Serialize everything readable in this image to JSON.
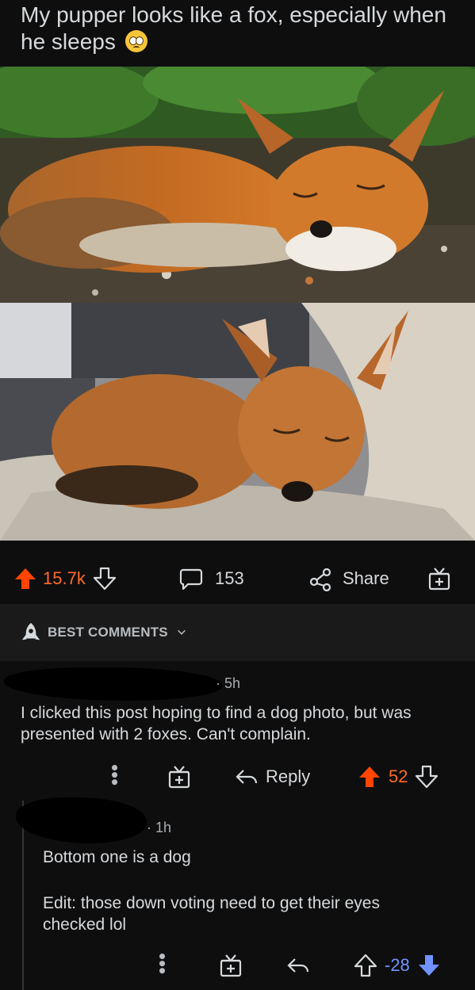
{
  "post": {
    "title": "My pupper looks like a fox, especially when he sleeps",
    "title_emoji": "pleading-face-emoji"
  },
  "actions": {
    "upvotes": "15.7k",
    "comments": "153",
    "share_label": "Share"
  },
  "comments_header": {
    "label": "BEST COMMENTS"
  },
  "comments": [
    {
      "age": "5h",
      "text": "I clicked this post hoping to find a dog photo, but was presented with 2 foxes. Can't complain.",
      "reply_label": "Reply",
      "score": "52"
    },
    {
      "age": "1h",
      "text_line1": "Bottom one is a dog",
      "text_line2": "Edit: those down voting need to get their eyes checked lol",
      "score": "-28"
    }
  ],
  "colors": {
    "upvote": "#ff4500",
    "downvote": "#7193ff",
    "background": "#0e0e0f"
  }
}
